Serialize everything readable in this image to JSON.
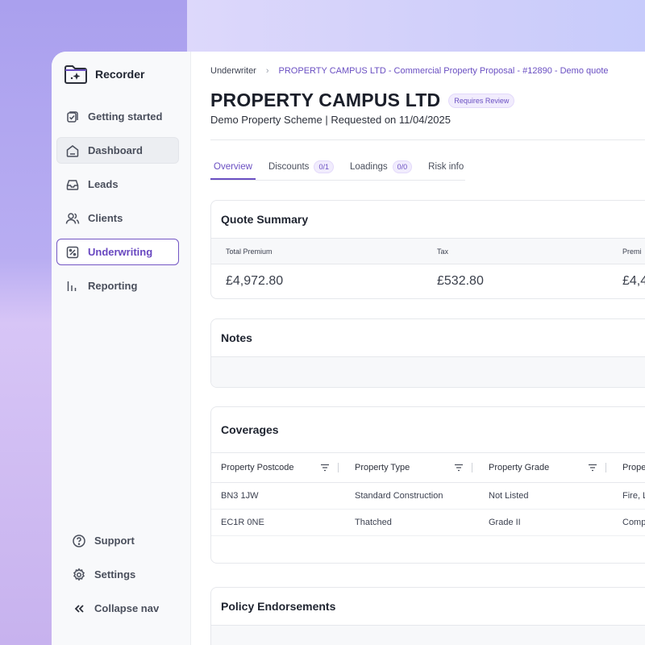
{
  "app": {
    "name": "Recorder"
  },
  "sidebar": {
    "items": [
      {
        "label": "Getting started",
        "icon": "checklist-icon",
        "state": "normal"
      },
      {
        "label": "Dashboard",
        "icon": "home-icon",
        "state": "hover"
      },
      {
        "label": "Leads",
        "icon": "inbox-icon",
        "state": "normal"
      },
      {
        "label": "Clients",
        "icon": "users-icon",
        "state": "normal"
      },
      {
        "label": "Underwriting",
        "icon": "percent-icon",
        "state": "active"
      },
      {
        "label": "Reporting",
        "icon": "bar-chart-icon",
        "state": "normal"
      }
    ],
    "bottom": [
      {
        "label": "Support",
        "icon": "help-icon"
      },
      {
        "label": "Settings",
        "icon": "gear-icon"
      },
      {
        "label": "Collapse nav",
        "icon": "double-chevron-left-icon"
      }
    ]
  },
  "breadcrumb": {
    "root": "Underwriter",
    "current": "PROPERTY CAMPUS LTD - Commercial Property Proposal - #12890 - Demo quote"
  },
  "header": {
    "title": "PROPERTY CAMPUS LTD",
    "badge": "Requires Review",
    "subtitle": "Demo Property Scheme | Requested on 11/04/2025"
  },
  "tabs": [
    {
      "label": "Overview",
      "count": ""
    },
    {
      "label": "Discounts",
      "count": "0/1"
    },
    {
      "label": "Loadings",
      "count": "0/0"
    },
    {
      "label": "Risk info",
      "count": ""
    }
  ],
  "quote_summary": {
    "title": "Quote Summary",
    "headers": [
      "Total Premium",
      "Tax",
      "Premi"
    ],
    "values": [
      "£4,972.80",
      "£532.80",
      "£4,4"
    ]
  },
  "notes": {
    "title": "Notes"
  },
  "coverages": {
    "title": "Coverages",
    "columns": [
      "Property Postcode",
      "Property Type",
      "Property Grade",
      "Prope"
    ],
    "rows": [
      [
        "BN3 1JW",
        "Standard Construction",
        "Not Listed",
        "Fire, L"
      ],
      [
        "EC1R 0NE",
        "Thatched",
        "Grade II",
        "Comp"
      ]
    ]
  },
  "endorsements": {
    "title": "Policy Endorsements"
  },
  "colors": {
    "accent": "#6a4fc2",
    "sidebar_bg": "#f8f9fb",
    "border": "#e6e8ec"
  }
}
